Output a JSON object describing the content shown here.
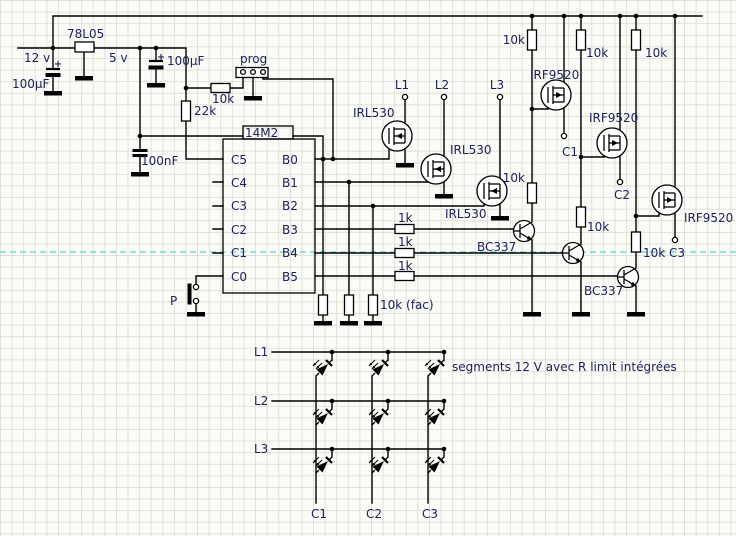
{
  "schematic": {
    "power": {
      "v_in": "12 v",
      "regulator": "78L05",
      "v_out": "5 v",
      "cap_in": "100µF",
      "cap_out": "100µF",
      "cap_bypass": "100nF",
      "polarity": "+"
    },
    "prog": {
      "label": "prog",
      "series_r": "10k",
      "pulldown_r": "22k"
    },
    "mcu": {
      "part": "14M2",
      "pins_left": [
        "C5",
        "C4",
        "C3",
        "C2",
        "C1",
        "C0"
      ],
      "pins_right": [
        "B0",
        "B1",
        "B2",
        "B3",
        "B4",
        "B5"
      ]
    },
    "button_label": "P",
    "rows_driver": {
      "fets": [
        "IRL530",
        "IRL530",
        "IRL530"
      ],
      "outputs": [
        "L1",
        "L2",
        "L3"
      ],
      "gate_pulldowns": "10k (fac)"
    },
    "cols_driver": {
      "pullups": [
        "10k",
        "10k",
        "10k"
      ],
      "fets": [
        "IRF9520",
        "IRF9520",
        "IRF9520"
      ],
      "gate_rs": [
        "10k",
        "10k",
        "10k"
      ],
      "npns": [
        "BC337",
        "BC337"
      ],
      "base_rs": [
        "1k",
        "1k",
        "1k"
      ],
      "outputs": [
        "C1",
        "C2",
        "C3"
      ]
    },
    "matrix": {
      "row_labels": [
        "L1",
        "L2",
        "L3"
      ],
      "col_labels": [
        "C1",
        "C2",
        "C3"
      ],
      "note": "segments 12 V avec R limit intégrées"
    }
  }
}
